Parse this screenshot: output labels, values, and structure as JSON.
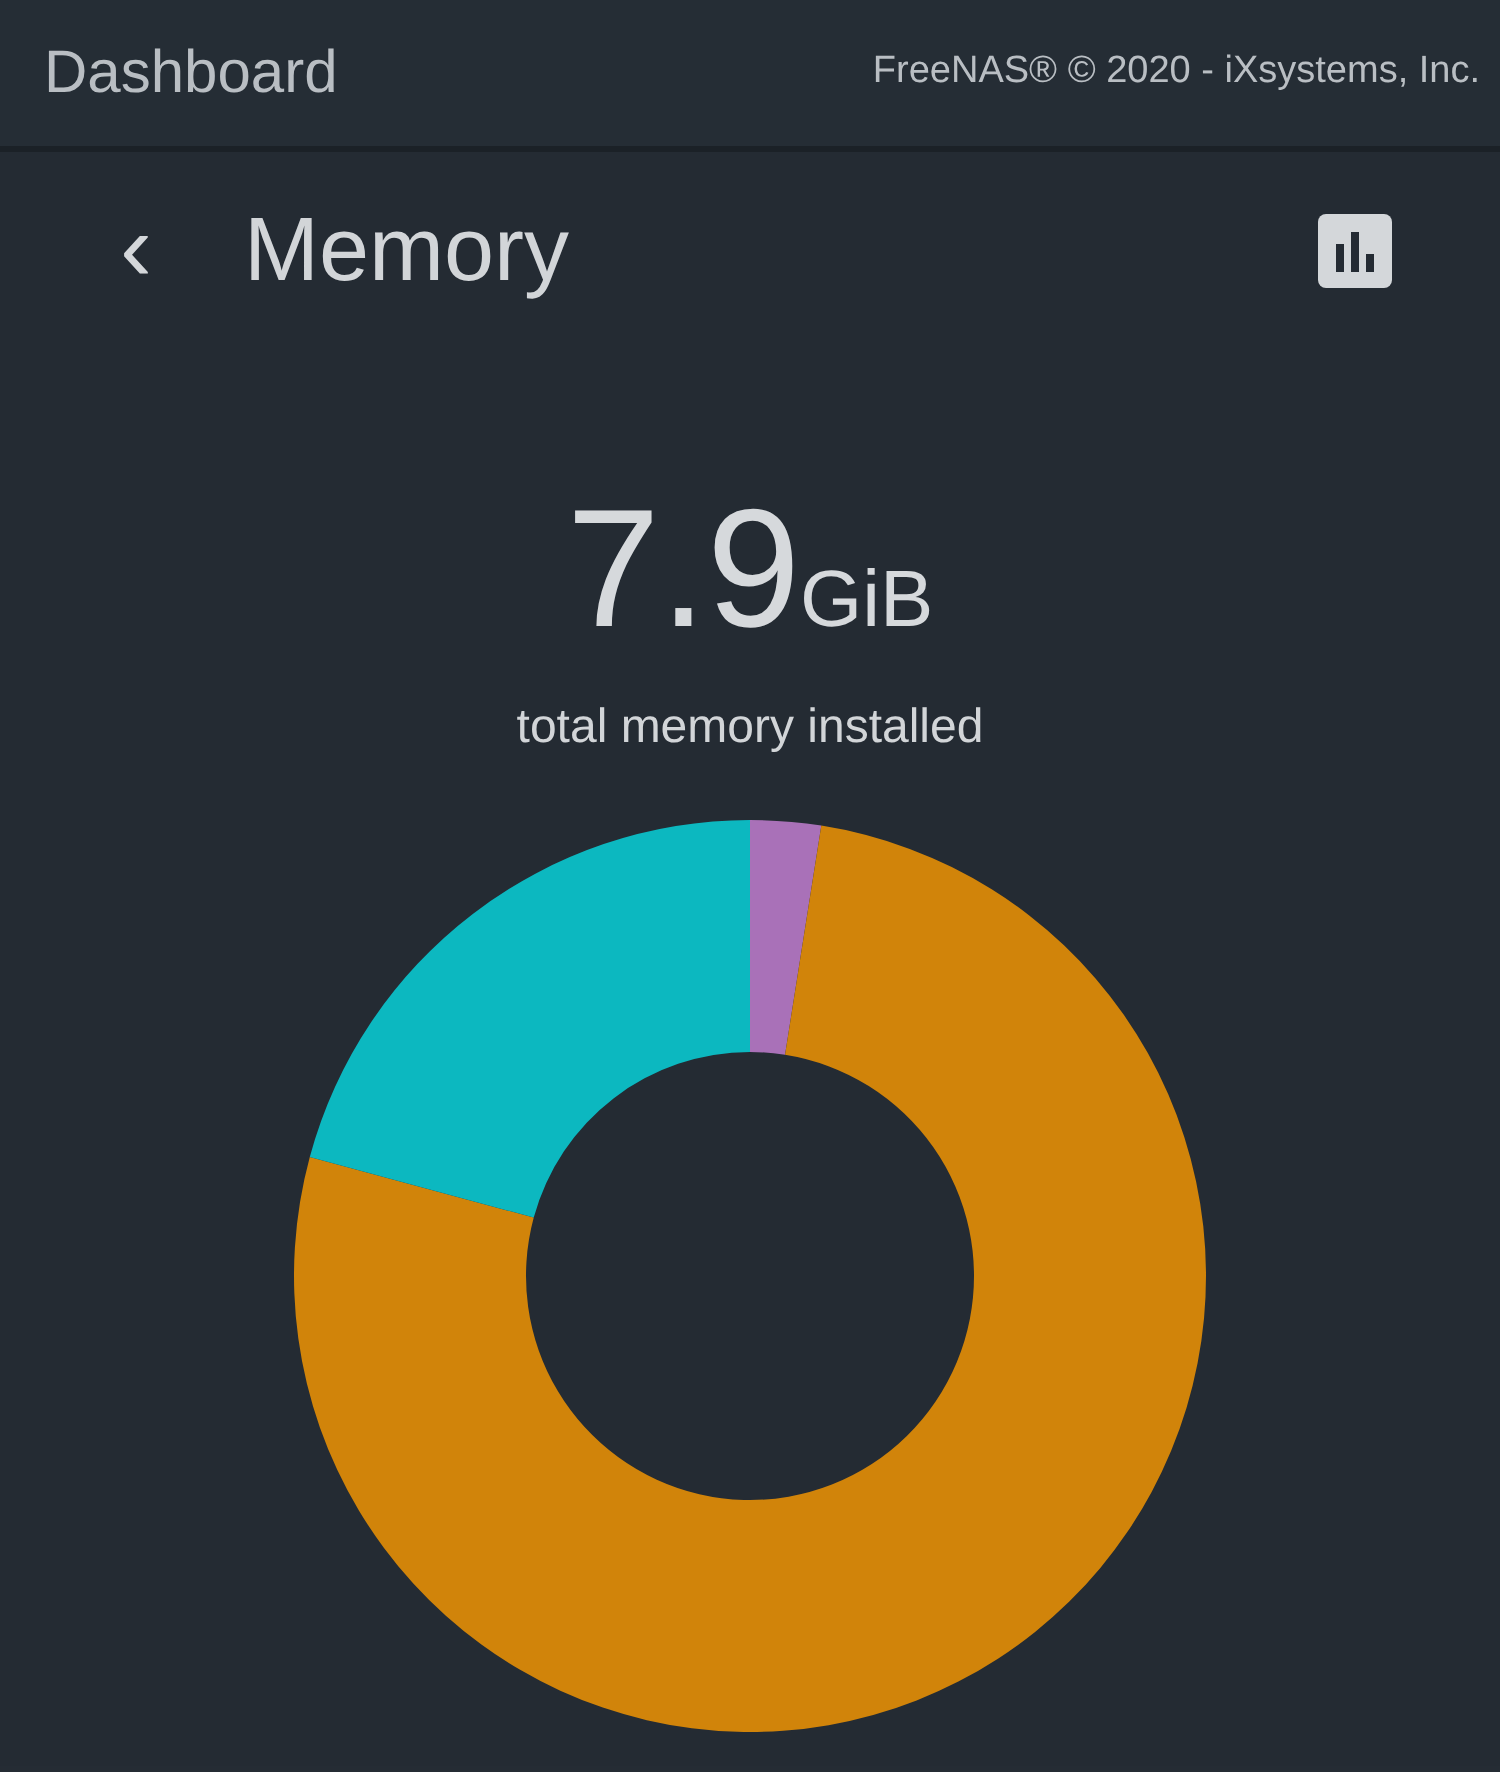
{
  "header": {
    "title": "Dashboard",
    "copyright": "FreeNAS® © 2020 - iXsystems, Inc."
  },
  "card": {
    "back": "‹",
    "title": "Memory",
    "total": {
      "value": "7.9",
      "unit": "GiB",
      "caption": "total memory installed"
    }
  }
}
